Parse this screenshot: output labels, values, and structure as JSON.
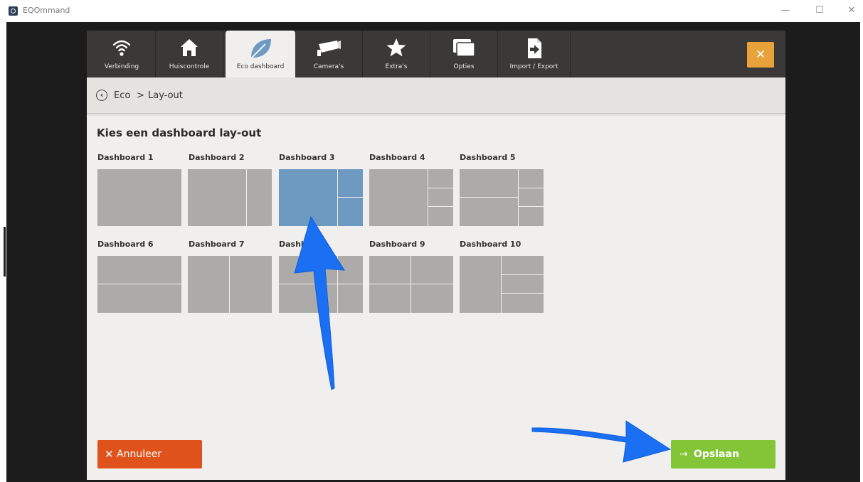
{
  "window": {
    "title": "EQOmmand",
    "controls": [
      "—",
      "☐",
      "✕"
    ]
  },
  "tabs": [
    {
      "label": "Verbinding",
      "icon": "wifi-icon"
    },
    {
      "label": "Huiscontrole",
      "icon": "home-icon"
    },
    {
      "label": "Eco dashboard",
      "icon": "leaf-icon",
      "active": true
    },
    {
      "label": "Camera's",
      "icon": "camera-icon"
    },
    {
      "label": "Extra's",
      "icon": "star-icon"
    },
    {
      "label": "Opties",
      "icon": "windows-icon"
    },
    {
      "label": "Import / Export",
      "icon": "import-export-icon"
    }
  ],
  "close_symbol": "✕",
  "breadcrumb": {
    "back_symbol": "‹",
    "root": "Eco",
    "separator": ">",
    "current": "Lay-out"
  },
  "section_title": "Kies een dashboard lay-out",
  "dashboards": [
    {
      "label": "Dashboard 1"
    },
    {
      "label": "Dashboard 2"
    },
    {
      "label": "Dashboard 3",
      "selected": true
    },
    {
      "label": "Dashboard 4"
    },
    {
      "label": "Dashboard 5"
    },
    {
      "label": "Dashboard 6"
    },
    {
      "label": "Dashboard 7"
    },
    {
      "label": "Dashb"
    },
    {
      "label": "Dashboard 9"
    },
    {
      "label": "Dashboard 10"
    }
  ],
  "buttons": {
    "cancel_symbol": "✕",
    "cancel_label": "Annuleer",
    "save_symbol": "→",
    "save_label": "Opslaan"
  },
  "colors": {
    "accent_close": "#e8a23a",
    "cancel": "#e0521c",
    "save": "#84c437",
    "selected_thumb": "#6e9ac2",
    "annotation_arrow": "#1a6ff2"
  }
}
